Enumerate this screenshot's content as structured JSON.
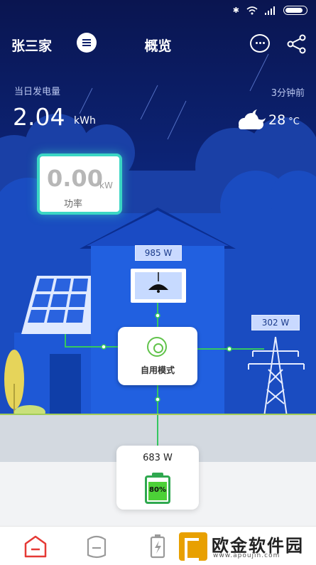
{
  "header": {
    "plant_name": "张三家",
    "title": "概览"
  },
  "generation": {
    "label": "当日发电量",
    "value": "2.04",
    "unit": "kWh",
    "updated": "3分钟前"
  },
  "weather": {
    "icon": "cloud-moon-icon",
    "temperature": "28",
    "temperature_unit": "°C"
  },
  "power": {
    "value": "0.00",
    "unit": "kW",
    "label": "功率"
  },
  "flows": {
    "load_watts": "985 W",
    "grid_watts": "302 W",
    "mode_label": "自用模式"
  },
  "battery": {
    "watts": "683 W",
    "percent_label": "80%",
    "percent": 80
  },
  "tabbar": {
    "tabs": [
      {
        "icon": "home-icon",
        "active": true
      },
      {
        "icon": "device-icon",
        "active": false
      },
      {
        "icon": "battery-charge-icon",
        "active": false
      }
    ]
  },
  "watermark": {
    "text": "欧金软件园",
    "sub": "www.apoujin.com"
  },
  "colors": {
    "accent": "#e53935",
    "flow_line": "#35c760",
    "card_glow": "#3bd6c4"
  }
}
